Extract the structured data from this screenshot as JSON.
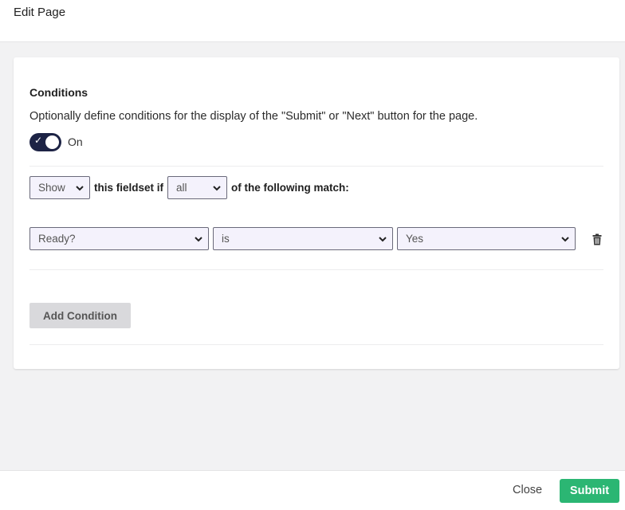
{
  "header": {
    "title": "Edit Page"
  },
  "conditions": {
    "title": "Conditions",
    "description": "Optionally define conditions for the display of the \"Submit\" or \"Next\" button for the page.",
    "toggle": {
      "on": true,
      "label": "On"
    },
    "rule": {
      "action": "Show",
      "text_middle": "this fieldset if",
      "match_mode": "all",
      "text_end": "of the following match:"
    },
    "condition_rows": [
      {
        "field": "Ready?",
        "operator": "is",
        "value": "Yes"
      }
    ],
    "add_button_label": "Add Condition"
  },
  "footer": {
    "close_label": "Close",
    "submit_label": "Submit"
  },
  "colors": {
    "accent": "#1d2345",
    "submit": "#2bb673",
    "select_bg": "#f4f2fc"
  }
}
